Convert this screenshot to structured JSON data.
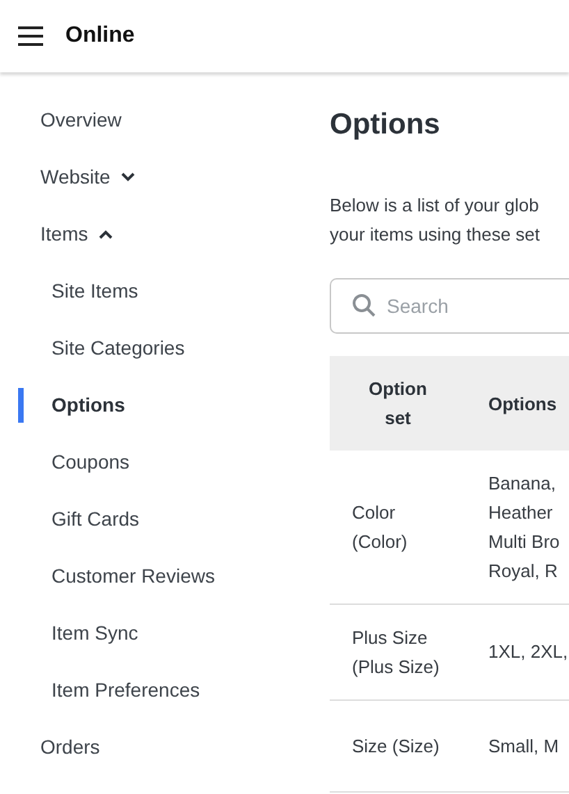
{
  "header": {
    "title": "Online"
  },
  "sidebar": {
    "items": [
      {
        "label": "Overview",
        "selected": false
      },
      {
        "label": "Website",
        "expanded": false,
        "selected": false
      },
      {
        "label": "Items",
        "expanded": true,
        "selected": false,
        "children": [
          {
            "label": "Site Items",
            "selected": false
          },
          {
            "label": "Site Categories",
            "selected": false
          },
          {
            "label": "Options",
            "selected": true
          },
          {
            "label": "Coupons",
            "selected": false
          },
          {
            "label": "Gift Cards",
            "selected": false
          },
          {
            "label": "Customer Reviews",
            "selected": false
          },
          {
            "label": "Item Sync",
            "selected": false
          },
          {
            "label": "Item Preferences",
            "selected": false
          }
        ]
      },
      {
        "label": "Orders",
        "selected": false
      }
    ]
  },
  "main": {
    "title": "Options",
    "description": "Below is a list of your glob\nyour items using these set",
    "search": {
      "placeholder": "Search"
    },
    "table": {
      "columns": [
        "Option set",
        "Options"
      ],
      "rows": [
        [
          "Color (Color)",
          "Banana,\nHeather\nMulti Bro\nRoyal, R"
        ],
        [
          "Plus Size (Plus Size)",
          "1XL, 2XL,"
        ],
        [
          "Size (Size)",
          "Small, M"
        ]
      ]
    }
  }
}
